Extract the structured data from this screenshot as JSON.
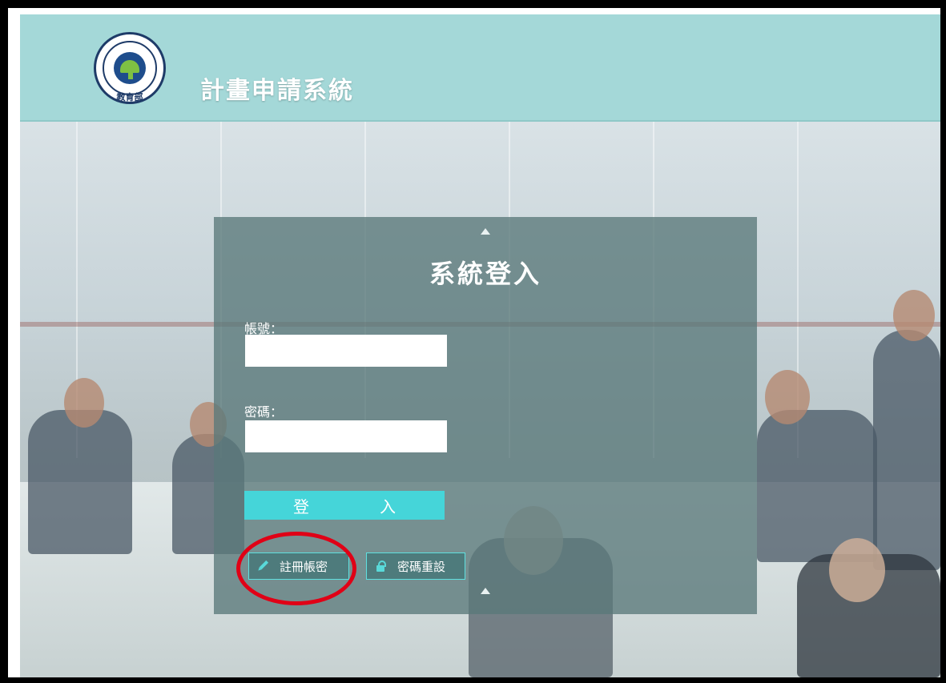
{
  "header": {
    "logo_name": "ministry-of-education-logo",
    "logo_text": "教育部",
    "logo_caption": "MINISTRY OF EDUCATION",
    "title": "計畫申請系統"
  },
  "login": {
    "title": "系統登入",
    "account_label": "帳號：",
    "account_value": "",
    "password_label": "密碼：",
    "password_value": "",
    "login_button": "登　入",
    "register_button": "註冊帳密",
    "reset_button": "密碼重設"
  },
  "icons": {
    "register": "pencil-icon",
    "reset": "lock-icon",
    "top_arrow": "triangle-up-icon",
    "bottom_arrow": "triangle-up-icon"
  },
  "colors": {
    "header_bg": "#a4d8d8",
    "panel_bg": "#5a787a",
    "login_button": "#45d5d9",
    "highlight": "#e00016"
  }
}
